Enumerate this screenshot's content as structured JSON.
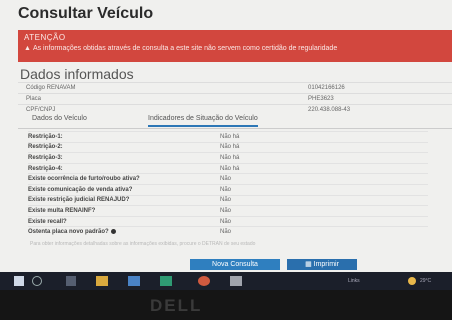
{
  "page_title": "Consultar Veículo",
  "alert": {
    "title": "ATENÇÃO",
    "message": "As informações obtidas através de consulta a este site não servem como certidão de regularidade"
  },
  "data_section": {
    "title": "Dados informados",
    "rows": [
      {
        "label": "Código RENAVAM",
        "value": "01042166126"
      },
      {
        "label": "Placa",
        "value": "PHE3623"
      },
      {
        "label": "CPF/CNPJ",
        "value": "220.438.088-43"
      }
    ]
  },
  "tabs": [
    {
      "label": "Dados do Veículo"
    },
    {
      "label": "Indicadores de Situação do Veículo"
    }
  ],
  "status_rows": [
    {
      "question": "Restrição-1:",
      "answer": "Não há"
    },
    {
      "question": "Restrição-2:",
      "answer": "Não há"
    },
    {
      "question": "Restrição-3:",
      "answer": "Não há"
    },
    {
      "question": "Restrição-4:",
      "answer": "Não há"
    },
    {
      "question": "Existe ocorrência de furto/roubo ativa?",
      "answer": "Não"
    },
    {
      "question": "Existe comunicação de venda ativa?",
      "answer": "Não"
    },
    {
      "question": "Existe restrição judicial RENAJUD?",
      "answer": "Não"
    },
    {
      "question": "Existe multa RENAINF?",
      "answer": "Não"
    },
    {
      "question": "Existe recall?",
      "answer": "Não"
    },
    {
      "question": "Ostenta placa novo padrão?",
      "answer": "Não"
    }
  ],
  "footnote": "Para obter informações detalhadas sobre as informações exibidas, procure o DETRAN de seu estado",
  "buttons": {
    "new_query": "Nova Consulta",
    "print": "Imprimir"
  },
  "taskbar": {
    "tray_text": "Links",
    "temperature": "29°C"
  },
  "bezel_logo": "DELL"
}
